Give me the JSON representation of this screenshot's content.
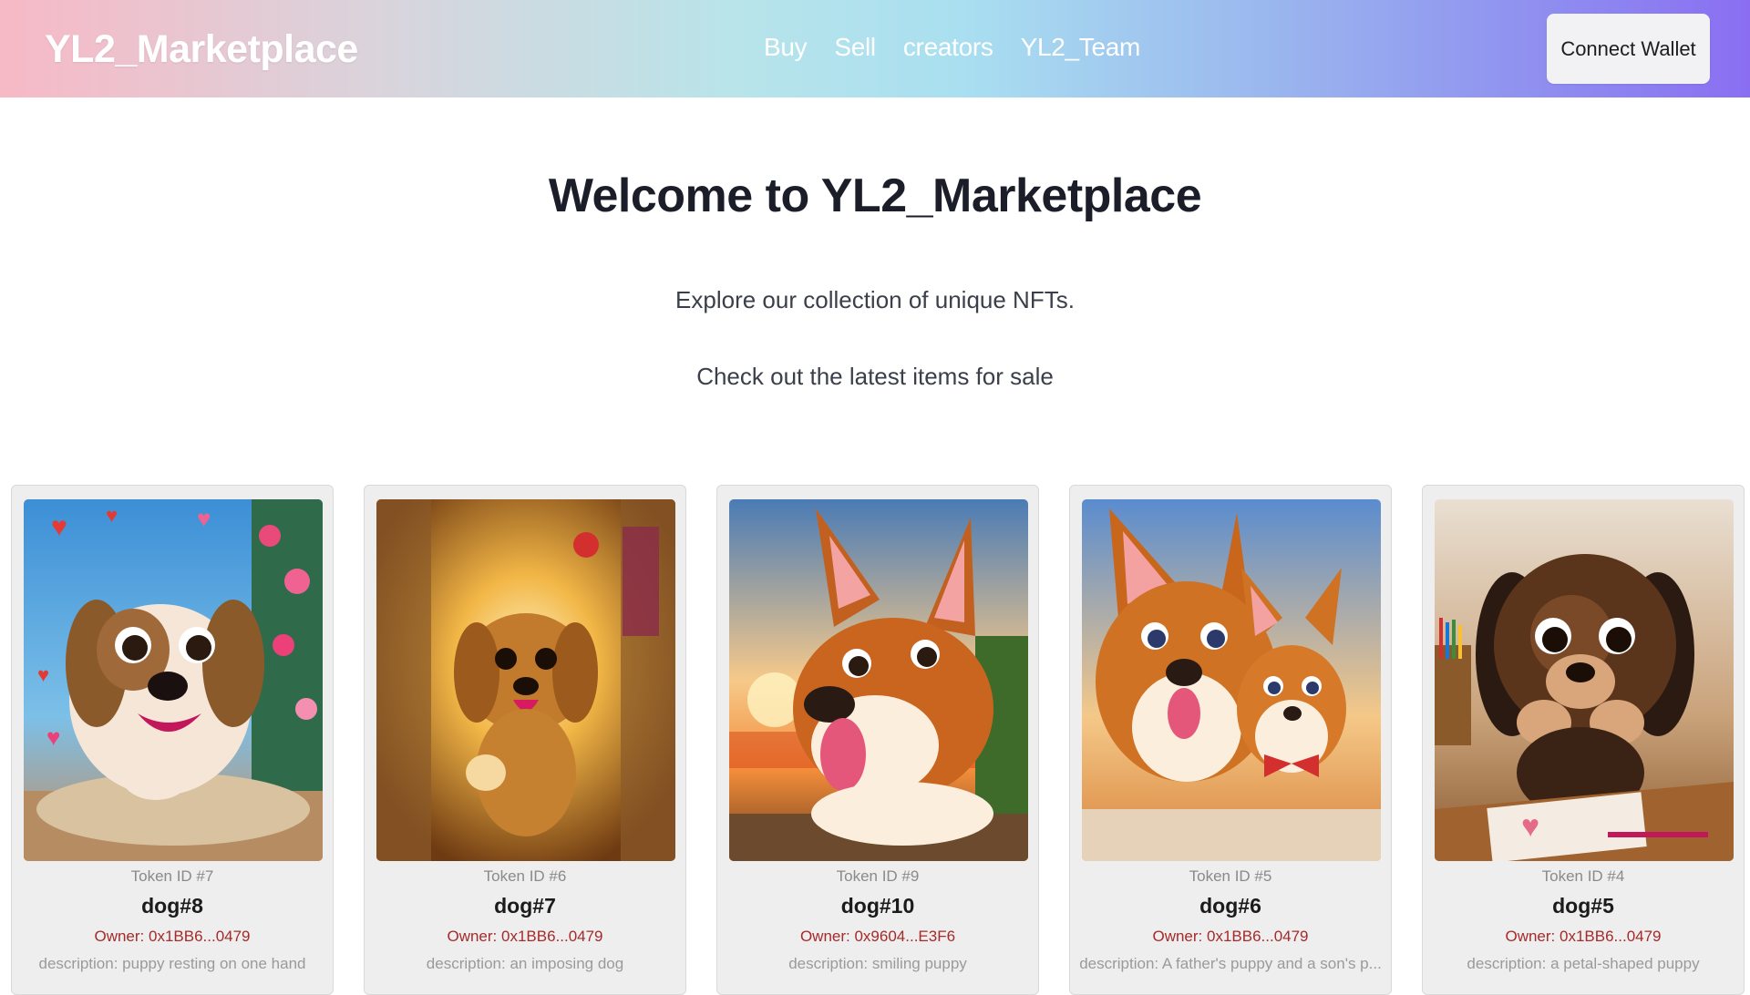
{
  "header": {
    "brand": "YL2_Marketplace",
    "nav": [
      "Buy",
      "Sell",
      "creators",
      "YL2_Team"
    ],
    "connect_label": "Connect Wallet"
  },
  "hero": {
    "title": "Welcome to YL2_Marketplace",
    "subtitle": "Explore our collection of unique NFTs.",
    "cta_text": "Check out the latest items for sale"
  },
  "cards": [
    {
      "token": "Token ID #7",
      "name": "dog#8",
      "owner": "Owner: 0x1BB6...0479",
      "description": "description: puppy resting on one hand"
    },
    {
      "token": "Token ID #6",
      "name": "dog#7",
      "owner": "Owner: 0x1BB6...0479",
      "description": "description: an imposing dog"
    },
    {
      "token": "Token ID #9",
      "name": "dog#10",
      "owner": "Owner: 0x9604...E3F6",
      "description": "description: smiling puppy"
    },
    {
      "token": "Token ID #5",
      "name": "dog#6",
      "owner": "Owner: 0x1BB6...0479",
      "description": "description: A father's puppy and a son's p..."
    },
    {
      "token": "Token ID #4",
      "name": "dog#5",
      "owner": "Owner: 0x1BB6...0479",
      "description": "description: a petal-shaped puppy"
    }
  ]
}
